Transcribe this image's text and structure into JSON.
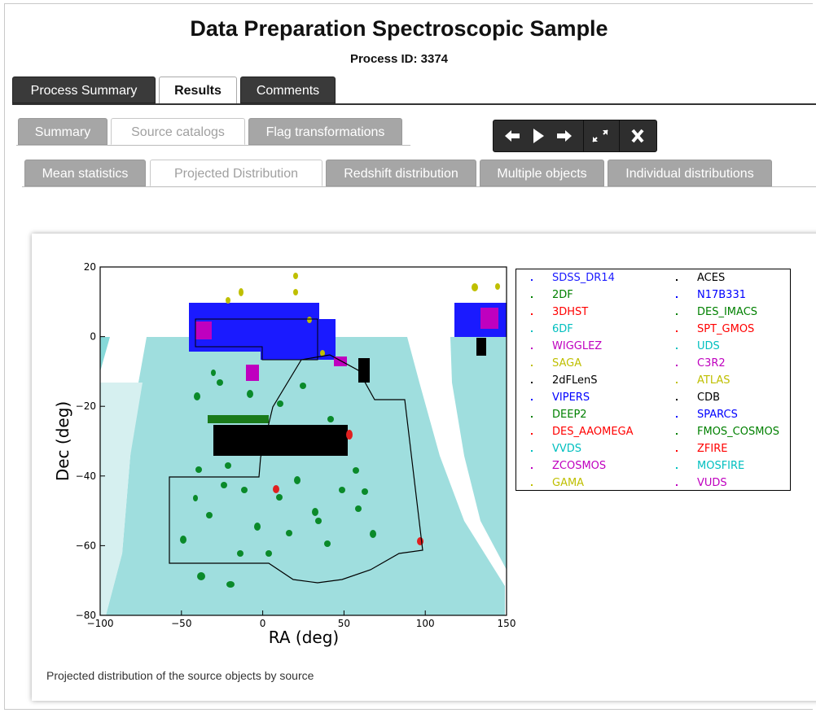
{
  "header": {
    "title": "Data Preparation Spectroscopic Sample",
    "process_id": "Process ID: 3374"
  },
  "main_tabs": [
    {
      "label": "Process Summary",
      "active": false
    },
    {
      "label": "Results",
      "active": true
    },
    {
      "label": "Comments",
      "active": false
    }
  ],
  "sub_tabs": [
    {
      "label": "Summary",
      "active": false
    },
    {
      "label": "Source catalogs",
      "active": true
    },
    {
      "label": "Flag transformations",
      "active": false
    }
  ],
  "view_tabs": [
    {
      "label": "Mean statistics",
      "active": false
    },
    {
      "label": "Projected Distribution",
      "active": true
    },
    {
      "label": "Redshift distribution",
      "active": false
    },
    {
      "label": "Multiple objects",
      "active": false
    },
    {
      "label": "Individual distributions",
      "active": false
    }
  ],
  "toolbar": {
    "icons": [
      "arrow-left-icon",
      "play-icon",
      "arrow-right-icon",
      "expand-icon",
      "close-icon"
    ]
  },
  "figure": {
    "caption": "Projected distribution of the source objects by source"
  },
  "chart_data": {
    "type": "scatter",
    "title": "",
    "xlabel": "RA (deg)",
    "ylabel": "Dec (deg)",
    "xlim": [
      -100,
      150
    ],
    "ylim": [
      -80,
      20
    ],
    "xticks": [
      -100,
      -50,
      0,
      50,
      100,
      150
    ],
    "yticks": [
      20,
      0,
      -20,
      -40,
      -60,
      -80
    ],
    "legend_position": "right",
    "series": [
      {
        "name": "SDSS_DR14",
        "color": "#1a1aff"
      },
      {
        "name": "2DF",
        "color": "#008000"
      },
      {
        "name": "3DHST",
        "color": "#ff0000"
      },
      {
        "name": "6DF",
        "color": "#00bfbf"
      },
      {
        "name": "WIGGLEZ",
        "color": "#bf00bf"
      },
      {
        "name": "SAGA",
        "color": "#bfbf00"
      },
      {
        "name": "2dFLenS",
        "color": "#000000"
      },
      {
        "name": "VIPERS",
        "color": "#0000ff"
      },
      {
        "name": "DEEP2",
        "color": "#008000"
      },
      {
        "name": "DES_AAOMEGA",
        "color": "#ff0000"
      },
      {
        "name": "VVDS",
        "color": "#00bfbf"
      },
      {
        "name": "ZCOSMOS",
        "color": "#bf00bf"
      },
      {
        "name": "GAMA",
        "color": "#bfbf00"
      },
      {
        "name": "ACES",
        "color": "#000000"
      },
      {
        "name": "N17B331",
        "color": "#0000ff"
      },
      {
        "name": "DES_IMACS",
        "color": "#008000"
      },
      {
        "name": "SPT_GMOS",
        "color": "#ff0000"
      },
      {
        "name": "UDS",
        "color": "#00bfbf"
      },
      {
        "name": "C3R2",
        "color": "#bf00bf"
      },
      {
        "name": "ATLAS",
        "color": "#bfbf00"
      },
      {
        "name": "CDB",
        "color": "#000000"
      },
      {
        "name": "SPARCS",
        "color": "#0000ff"
      },
      {
        "name": "FMOS_COSMOS",
        "color": "#008000"
      },
      {
        "name": "ZFIRE",
        "color": "#ff0000"
      },
      {
        "name": "MOSFIRE",
        "color": "#00bfbf"
      },
      {
        "name": "VUDS",
        "color": "#bf00bf"
      }
    ]
  }
}
